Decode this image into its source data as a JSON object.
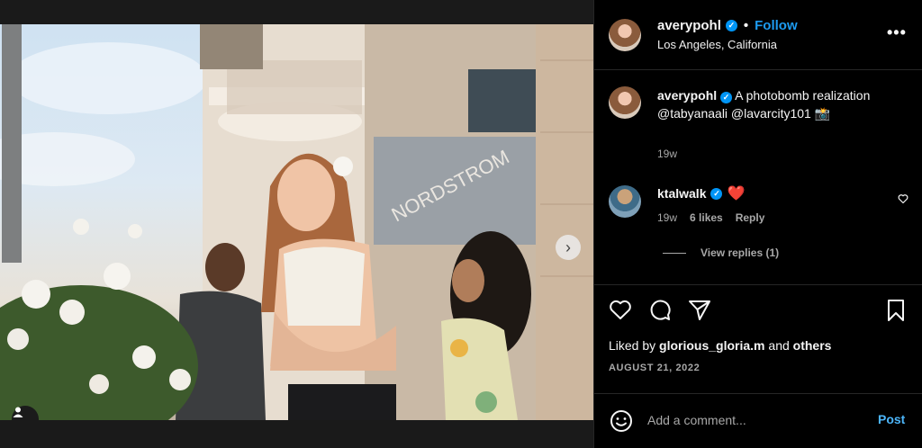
{
  "post": {
    "username": "averypohl",
    "follow_label": "Follow",
    "location": "Los Angeles, California",
    "more_label": "•••",
    "separator": "•"
  },
  "caption": {
    "username": "averypohl",
    "text": "A photobomb realization @tabyanaali @lavarcity101 📸",
    "time": "19w"
  },
  "comment": {
    "username": "ktalwalk",
    "text": "❤️",
    "time": "19w",
    "likes": "6 likes",
    "reply_label": "Reply",
    "view_replies": "View replies (1)"
  },
  "likes": {
    "prefix": "Liked by",
    "user": "glorious_gloria.m",
    "joiner": "and",
    "others": "others"
  },
  "date": "AUGUST 21, 2022",
  "composer": {
    "placeholder": "Add a comment...",
    "post_label": "Post"
  },
  "icons": {
    "verified": "verified-badge-icon",
    "like": "heart-icon",
    "comment": "comment-bubble-icon",
    "share": "paper-plane-icon",
    "save": "bookmark-icon",
    "emoji": "smiley-icon",
    "next": "chevron-right-icon",
    "tag": "user-tag-icon"
  },
  "colors": {
    "accent": "#0095f6",
    "link": "#4cb5f9",
    "heart": "#ed1c24"
  }
}
